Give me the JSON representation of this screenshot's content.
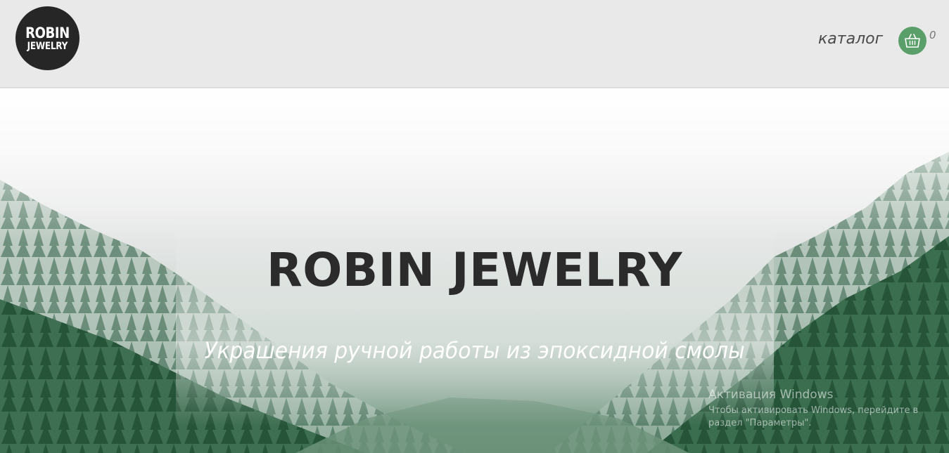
{
  "header": {
    "logo": {
      "line1": "ROBIN",
      "line2": "JEWELRY"
    },
    "nav": {
      "catalog_label": "каталог"
    },
    "cart": {
      "icon": "basket-icon",
      "count": "0",
      "color": "#5a9f6a"
    }
  },
  "hero": {
    "title": "ROBIN JEWELRY",
    "subtitle": "Украшения ручной работы из эпоксидной смолы",
    "background": "misty-forest-image"
  },
  "watermark": {
    "title": "Активация Windows",
    "text": "Чтобы активировать Windows, перейдите в раздел \"Параметры\"."
  }
}
